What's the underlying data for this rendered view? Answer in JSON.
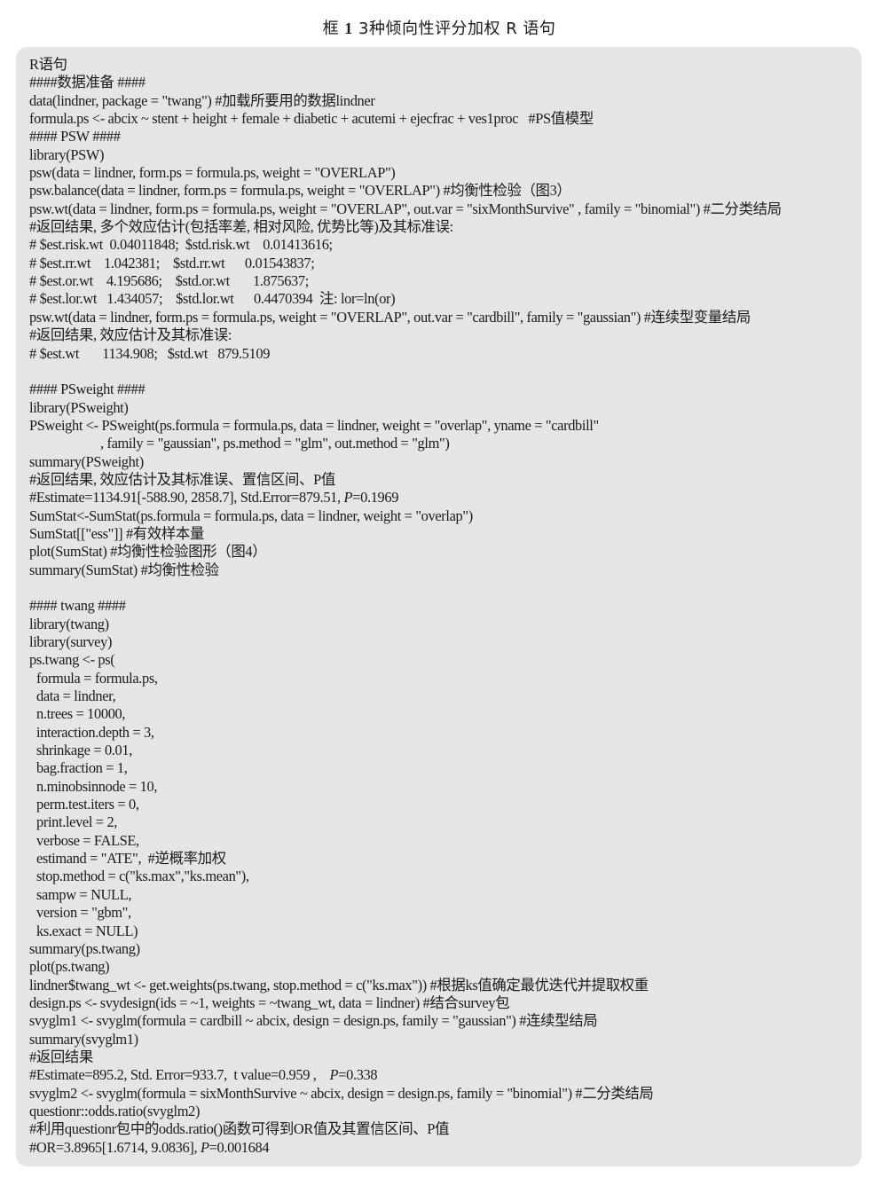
{
  "title": {
    "prefix": "框",
    "number": "1",
    "text": "3种倾向性评分加权 R 语句"
  },
  "code_box": {
    "heading": "R语句",
    "lines": [
      {
        "kind": "comment-section",
        "text": "####数据准备 ####"
      },
      {
        "kind": "code",
        "text": "data(lindner, package = \"twang\") #加载所要用的数据lindner"
      },
      {
        "kind": "code",
        "text": "formula.ps <- abcix ~ stent + height + female + diabetic + acutemi + ejecfrac + ves1proc   #PS值模型"
      },
      {
        "kind": "comment-section",
        "text": "#### PSW ####"
      },
      {
        "kind": "code",
        "text": "library(PSW)"
      },
      {
        "kind": "code",
        "text": "psw(data = lindner, form.ps = formula.ps, weight = \"OVERLAP\")"
      },
      {
        "kind": "code",
        "text": "psw.balance(data = lindner, form.ps = formula.ps, weight = \"OVERLAP\") #均衡性检验（图3）"
      },
      {
        "kind": "code",
        "text": "psw.wt(data = lindner, form.ps = formula.ps, weight = \"OVERLAP\", out.var = \"sixMonthSurvive\" , family = \"binomial\") #二分类结局"
      },
      {
        "kind": "comment",
        "text": "#返回结果, 多个效应估计(包括率差, 相对风险, 优势比等)及其标准误:"
      },
      {
        "kind": "comment",
        "text": "# $est.risk.wt  0.04011848;  $std.risk.wt    0.01413616;"
      },
      {
        "kind": "comment",
        "text": "# $est.rr.wt    1.042381;    $std.rr.wt      0.01543837;"
      },
      {
        "kind": "comment",
        "text": "# $est.or.wt    4.195686;    $std.or.wt       1.875637;"
      },
      {
        "kind": "comment",
        "text": "# $est.lor.wt   1.434057;    $std.lor.wt      0.4470394  注: lor=ln(or)"
      },
      {
        "kind": "code",
        "text": "psw.wt(data = lindner, form.ps = formula.ps, weight = \"OVERLAP\", out.var = \"cardbill\", family = \"gaussian\") #连续型变量结局"
      },
      {
        "kind": "comment",
        "text": "#返回结果, 效应估计及其标准误:"
      },
      {
        "kind": "comment",
        "text": "# $est.wt       1134.908;   $std.wt   879.5109"
      },
      {
        "kind": "blank",
        "text": ""
      },
      {
        "kind": "comment-section",
        "text": "#### PSweight ####"
      },
      {
        "kind": "code",
        "text": "library(PSweight)"
      },
      {
        "kind": "code",
        "text": "PSweight <- PSweight(ps.formula = formula.ps, data = lindner, weight = \"overlap\", yname = \"cardbill\""
      },
      {
        "kind": "code-cont",
        "text": ", family = \"gaussian\", ps.method = \"glm\", out.method = \"glm\")"
      },
      {
        "kind": "code",
        "text": "summary(PSweight)"
      },
      {
        "kind": "comment",
        "text": "#返回结果, 效应估计及其标准误、置信区间、P值"
      },
      {
        "kind": "comment-p",
        "before": "#Estimate=1134.91[-588.90, 2858.7], Std.Error=879.51, ",
        "italic": "P",
        "after": "=0.1969"
      },
      {
        "kind": "code",
        "text": "SumStat<-SumStat(ps.formula = formula.ps, data = lindner, weight = \"overlap\")"
      },
      {
        "kind": "code",
        "text": "SumStat[[\"ess\"]] #有效样本量"
      },
      {
        "kind": "code",
        "text": "plot(SumStat) #均衡性检验图形（图4）"
      },
      {
        "kind": "code",
        "text": "summary(SumStat) #均衡性检验"
      },
      {
        "kind": "blank",
        "text": ""
      },
      {
        "kind": "comment-section",
        "text": "#### twang ####"
      },
      {
        "kind": "code",
        "text": "library(twang)"
      },
      {
        "kind": "code",
        "text": "library(survey)"
      },
      {
        "kind": "code",
        "text": "ps.twang <- ps("
      },
      {
        "kind": "code-arg",
        "text": "formula = formula.ps,"
      },
      {
        "kind": "code-arg",
        "text": "data = lindner,"
      },
      {
        "kind": "code-arg",
        "text": "n.trees = 10000,"
      },
      {
        "kind": "code-arg",
        "text": "interaction.depth = 3,"
      },
      {
        "kind": "code-arg",
        "text": "shrinkage = 0.01,"
      },
      {
        "kind": "code-arg",
        "text": "bag.fraction = 1,"
      },
      {
        "kind": "code-arg",
        "text": "n.minobsinnode = 10,"
      },
      {
        "kind": "code-arg",
        "text": "perm.test.iters = 0,"
      },
      {
        "kind": "code-arg",
        "text": "print.level = 2,"
      },
      {
        "kind": "code-arg",
        "text": "verbose = FALSE,"
      },
      {
        "kind": "code-arg",
        "text": "estimand = \"ATE\",  #逆概率加权"
      },
      {
        "kind": "code-arg",
        "text": "stop.method = c(\"ks.max\",\"ks.mean\"),"
      },
      {
        "kind": "code-arg",
        "text": "sampw = NULL,"
      },
      {
        "kind": "code-arg",
        "text": "version = \"gbm\","
      },
      {
        "kind": "code-arg",
        "text": "ks.exact = NULL)"
      },
      {
        "kind": "code",
        "text": "summary(ps.twang)"
      },
      {
        "kind": "code",
        "text": "plot(ps.twang)"
      },
      {
        "kind": "code",
        "text": "lindner$twang_wt <- get.weights(ps.twang, stop.method = c(\"ks.max\")) #根据ks值确定最优迭代并提取权重"
      },
      {
        "kind": "code",
        "text": "design.ps <- svydesign(ids = ~1, weights = ~twang_wt, data = lindner) #结合survey包"
      },
      {
        "kind": "code",
        "text": "svyglm1 <- svyglm(formula = cardbill ~ abcix, design = design.ps, family = \"gaussian\") #连续型结局"
      },
      {
        "kind": "code",
        "text": "summary(svyglm1)"
      },
      {
        "kind": "comment",
        "text": "#返回结果"
      },
      {
        "kind": "comment-p",
        "before": "#Estimate=895.2, Std. Error=933.7,  t value=0.959 ,    ",
        "italic": "P",
        "after": "=0.338"
      },
      {
        "kind": "code",
        "text": "svyglm2 <- svyglm(formula = sixMonthSurvive ~ abcix, design = design.ps, family = \"binomial\") #二分类结局"
      },
      {
        "kind": "code",
        "text": "questionr::odds.ratio(svyglm2)"
      },
      {
        "kind": "comment",
        "text": "#利用questionr包中的odds.ratio()函数可得到OR值及其置信区间、P值"
      },
      {
        "kind": "comment-p",
        "before": "#OR=3.8965[1.6714, 9.0836], ",
        "italic": "P",
        "after": "=0.001684"
      }
    ]
  }
}
